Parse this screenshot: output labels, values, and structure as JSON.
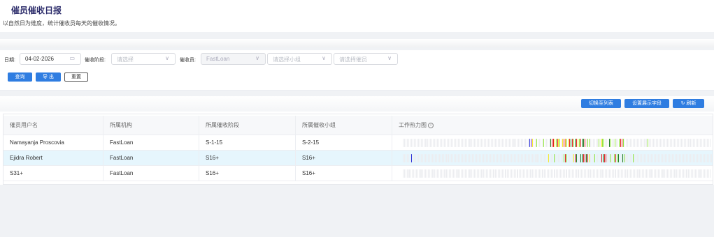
{
  "page": {
    "title": "催员催收日报",
    "description": "以自然日为维度，统计催收员每天的催收情况。"
  },
  "filters": {
    "date_label": "日期:",
    "date_value": "04-02-2026",
    "stage_label": "催收阶段:",
    "stage_placeholder": "请选择",
    "collector_label": "催收员:",
    "org_value": "FastLoan",
    "group_placeholder": "请选择小组",
    "collector_placeholder": "请选择催员",
    "calendar_icon": "calendar-icon",
    "chevron_icon": "chevron-down-icon"
  },
  "actions": {
    "query": "查询",
    "export": "导 出",
    "reset": "重置"
  },
  "toolbar": {
    "switch_list": "切换至列表",
    "set_fields": "设置展示字段",
    "refresh": "刷新",
    "refresh_icon": "refresh-icon"
  },
  "table": {
    "columns": [
      "催员用户名",
      "所属机构",
      "所属催收阶段",
      "所属催收小组",
      "工作热力图"
    ],
    "info_icon": "info-icon",
    "rows": [
      {
        "name": "Namayanja Proscovia",
        "org": "FastLoan",
        "stage": "S-1-15",
        "group": "S-2-15",
        "highlight": false
      },
      {
        "name": "Ejidra Robert",
        "org": "FastLoan",
        "stage": "S16+",
        "group": "S16+",
        "highlight": true
      },
      {
        "name": "S31+",
        "org": "FastLoan",
        "stage": "S16+",
        "group": "S16+",
        "highlight": false
      }
    ]
  },
  "heatmap_colors": {
    "empty": "#ecedf0",
    "blue": "#2a2fd6",
    "purple": "#7b2fd6",
    "green": "#8fe23a",
    "dkgreen": "#1e7a22",
    "yellow": "#f5e92a",
    "orange": "#f0a02a",
    "red": "#e02020",
    "dkred": "#a01818"
  },
  "heatmap_rows": [
    "eeeeeeeeeeeeeeeeeeeeeeeeeeeeeeeeeeeeeeeeeeeeeeeeeeeeeeeeeeeeeeeeeeeeeeeeeeeeeeeeeeeeeeeeeeeebpyeegeeeegeeeedrrygrygeyrogyrdrgdrygrddreggeeeeeegeyggeeedgeegeegrrgeeeeeeeeeeeeeeeeegeeeeeeeeeeeeeeeeeeeeeeeeeeeeeeeeeeeeeeeeeeeee",
    "eeeeeebeeeeeeeeeeeeeeeeeeeeeeeeeeeeeeeeeeeeeeeeeeeeeeeeeeeeeeeeeeeeeeeeeeeeeeeeeeeeeeeeeeeeeeeeeeeeeeeeeeyeeegeeeeeegrgeeeeyrdeeddrrdryeeegeeeerdrreegeegrgdeedgeeeeeegeeeeeeeeeeeeeeeeeeeeeeeeeeeeeeeeeeeeeeeeeeeeeeeeeeeeeeee",
    "eeeeeeeeeeeeeeeeeeeeeeeeeeeeeeeeeeeeeeeeeeeeeeeeeeeeeeeeeeeeeeeeeeeeeeeeeeeeeeeeeeeeeeeeeeeeeeeeeeeeeeeeeeeeeeeeeeeeeeeeeeeeeeeeeeeeeeeeeeeeeeeeeeeeeeeeeeeeeeeeeeeeeeeeeeeeeeeeeeeeeeeeeeeeeeeeeeeeeeeeeeeeeeeeeeeeeeeeeeeeeeeeeeeeeeeee"
  ]
}
